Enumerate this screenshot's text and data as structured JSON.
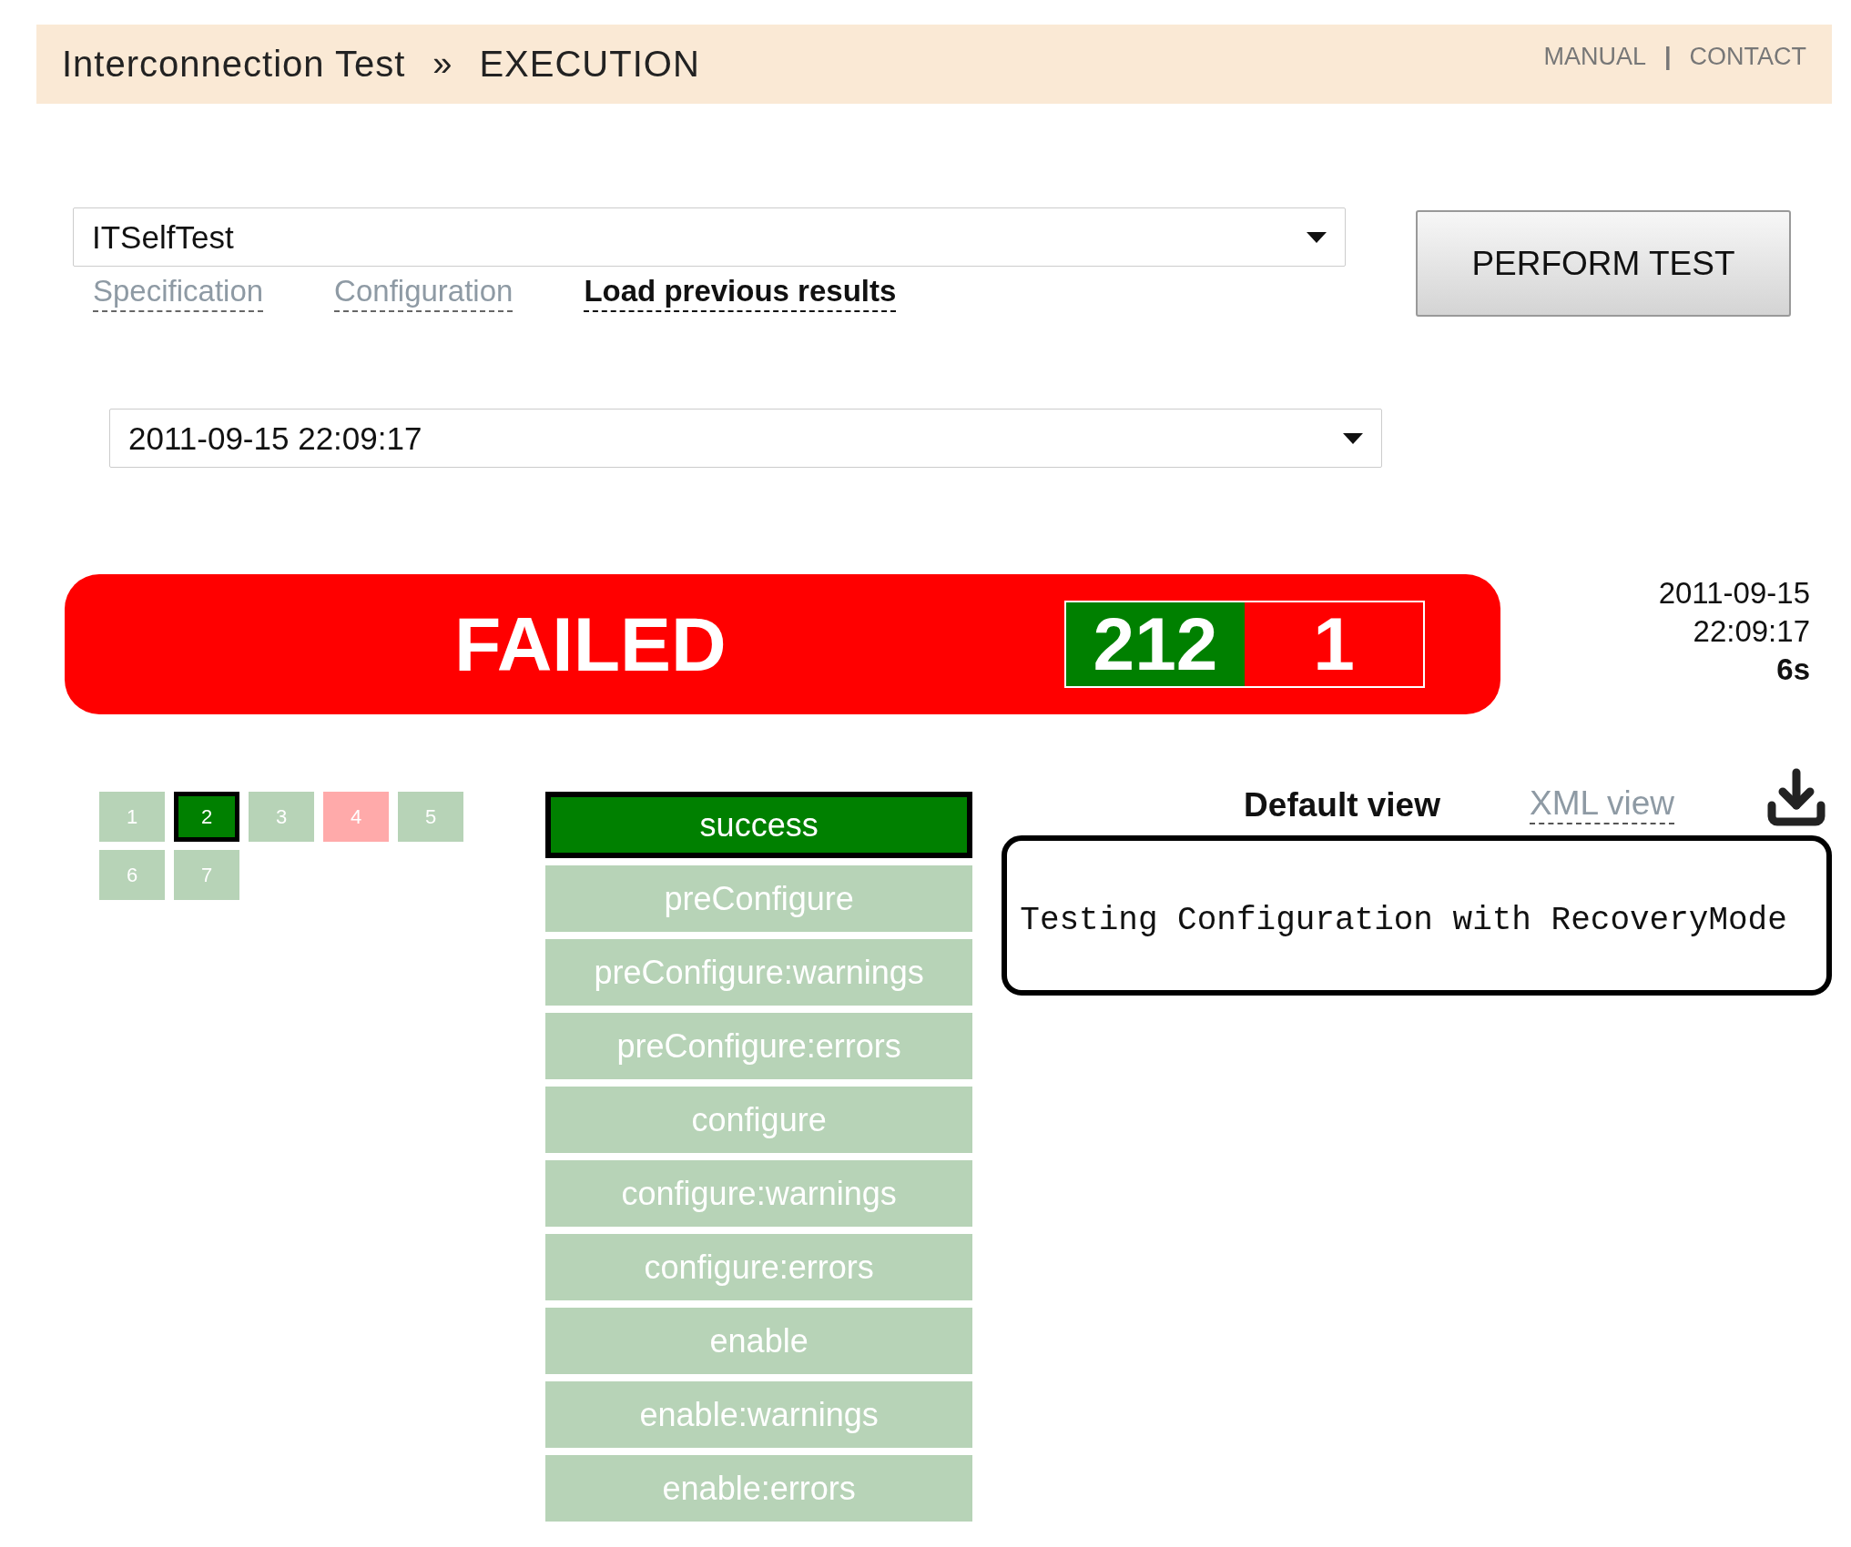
{
  "header": {
    "title": "Interconnection Test",
    "separator": "»",
    "page": "EXECUTION",
    "links": [
      "MANUAL",
      "CONTACT"
    ],
    "link_separator": "|"
  },
  "test_select": {
    "value": "ITSelfTest"
  },
  "tabs": [
    {
      "label": "Specification",
      "selected": false
    },
    {
      "label": "Configuration",
      "selected": false
    },
    {
      "label": "Load previous results",
      "selected": true
    }
  ],
  "perform_button": "PERFORM TEST",
  "results_select": {
    "value": "2011-09-15 22:09:17"
  },
  "status": {
    "label": "FAILED",
    "passed": "212",
    "failed": "1"
  },
  "run_info": {
    "date": "2011-09-15",
    "time": "22:09:17",
    "duration": "6s"
  },
  "pages": [
    {
      "label": "1",
      "selected": false,
      "color": "#b7d3b7"
    },
    {
      "label": "2",
      "selected": true,
      "color": "#008000"
    },
    {
      "label": "3",
      "selected": false,
      "color": "#b7d3b7"
    },
    {
      "label": "4",
      "selected": false,
      "color": "#ffaaaa"
    },
    {
      "label": "5",
      "selected": false,
      "color": "#b7d3b7"
    },
    {
      "label": "6",
      "selected": false,
      "color": "#b7d3b7"
    },
    {
      "label": "7",
      "selected": false,
      "color": "#b7d3b7"
    }
  ],
  "steps": [
    {
      "label": "success",
      "selected": true
    },
    {
      "label": "preConfigure",
      "selected": false
    },
    {
      "label": "preConfigure:warnings",
      "selected": false
    },
    {
      "label": "preConfigure:errors",
      "selected": false
    },
    {
      "label": "configure",
      "selected": false
    },
    {
      "label": "configure:warnings",
      "selected": false
    },
    {
      "label": "configure:errors",
      "selected": false
    },
    {
      "label": "enable",
      "selected": false
    },
    {
      "label": "enable:warnings",
      "selected": false
    },
    {
      "label": "enable:errors",
      "selected": false
    }
  ],
  "views": [
    {
      "label": "Default view",
      "selected": true
    },
    {
      "label": "XML view",
      "selected": false
    }
  ],
  "output": "Testing Configuration with RecoveryMode"
}
